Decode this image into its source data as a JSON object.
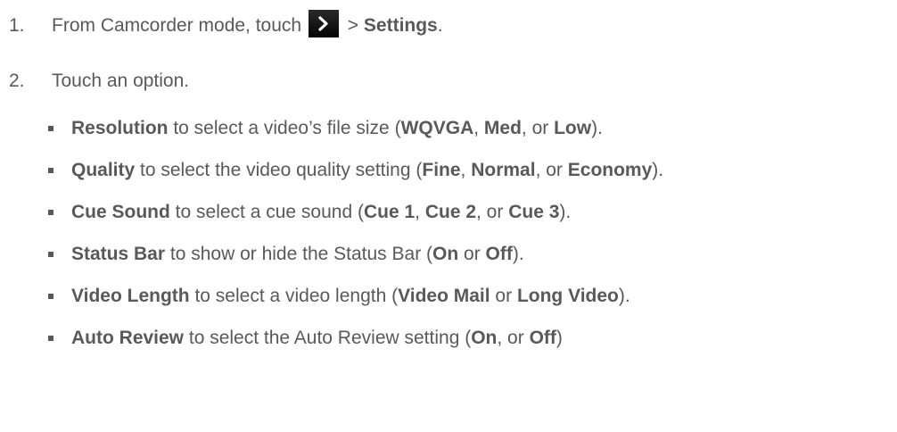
{
  "steps": [
    {
      "num": "1.",
      "before": "From Camcorder mode, touch",
      "icon": "chevron-right-icon",
      "between": " > ",
      "bold": "Settings",
      "after": "."
    },
    {
      "num": "2.",
      "text": "Touch an option."
    }
  ],
  "options": [
    {
      "parts": [
        {
          "t": "Resolution",
          "b": true
        },
        {
          "t": " to select a video’s file size (",
          "b": false
        },
        {
          "t": "WQVGA",
          "b": true
        },
        {
          "t": ", ",
          "b": false
        },
        {
          "t": "Med",
          "b": true
        },
        {
          "t": ", or ",
          "b": false
        },
        {
          "t": "Low",
          "b": true
        },
        {
          "t": ").",
          "b": false
        }
      ]
    },
    {
      "parts": [
        {
          "t": "Quality",
          "b": true
        },
        {
          "t": " to select the video quality setting (",
          "b": false
        },
        {
          "t": "Fine",
          "b": true
        },
        {
          "t": ", ",
          "b": false
        },
        {
          "t": "Normal",
          "b": true
        },
        {
          "t": ", or ",
          "b": false
        },
        {
          "t": "Economy",
          "b": true
        },
        {
          "t": ").",
          "b": false
        }
      ]
    },
    {
      "parts": [
        {
          "t": "Cue Sound",
          "b": true
        },
        {
          "t": " to select a cue sound (",
          "b": false
        },
        {
          "t": "Cue 1",
          "b": true
        },
        {
          "t": ", ",
          "b": false
        },
        {
          "t": "Cue 2",
          "b": true
        },
        {
          "t": ", or ",
          "b": false
        },
        {
          "t": "Cue 3",
          "b": true
        },
        {
          "t": ").",
          "b": false
        }
      ]
    },
    {
      "parts": [
        {
          "t": "Status Bar",
          "b": true
        },
        {
          "t": " to show or hide the Status Bar (",
          "b": false
        },
        {
          "t": "On",
          "b": true
        },
        {
          "t": " or ",
          "b": false
        },
        {
          "t": "Off",
          "b": true
        },
        {
          "t": ").",
          "b": false
        }
      ]
    },
    {
      "parts": [
        {
          "t": "Video Length",
          "b": true
        },
        {
          "t": " to select a video length (",
          "b": false
        },
        {
          "t": "Video Mail",
          "b": true
        },
        {
          "t": " or ",
          "b": false
        },
        {
          "t": "Long Video",
          "b": true
        },
        {
          "t": ").",
          "b": false
        }
      ]
    },
    {
      "parts": [
        {
          "t": "Auto Review",
          "b": true
        },
        {
          "t": " to select the Auto Review setting (",
          "b": false
        },
        {
          "t": "On",
          "b": true
        },
        {
          "t": ", or ",
          "b": false
        },
        {
          "t": "Off",
          "b": true
        },
        {
          "t": ")",
          "b": false
        }
      ]
    }
  ]
}
